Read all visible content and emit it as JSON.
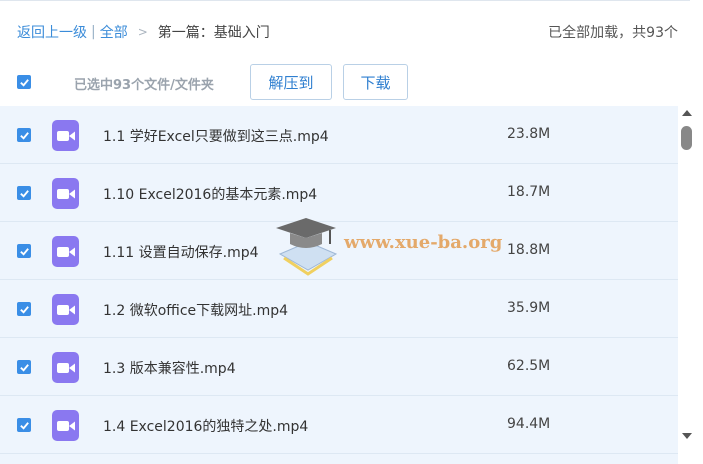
{
  "breadcrumb": {
    "back": "返回上一级",
    "separator": "|",
    "all": "全部",
    "arrow": ">",
    "current": "第一篇：基础入门"
  },
  "status": {
    "loaded_text": "已全部加载，共93个"
  },
  "toolbar": {
    "selected_text": "已选中93个文件/文件夹",
    "extract_label": "解压到",
    "download_label": "下载"
  },
  "files": [
    {
      "name": "1.1 学好Excel只要做到这三点.mp4",
      "size": "23.8M"
    },
    {
      "name": "1.10 Excel2016的基本元素.mp4",
      "size": "18.7M"
    },
    {
      "name": "1.11 设置自动保存.mp4",
      "size": "18.8M"
    },
    {
      "name": "1.2 微软office下载网址.mp4",
      "size": "35.9M"
    },
    {
      "name": "1.3 版本兼容性.mp4",
      "size": "62.5M"
    },
    {
      "name": "1.4 Excel2016的独特之处.mp4",
      "size": "94.4M"
    }
  ],
  "watermark": {
    "text": "www.xue-ba.org"
  },
  "colors": {
    "accent": "#3a8ee6",
    "file_icon": "#8a78f0",
    "list_bg": "#eef5fd"
  }
}
